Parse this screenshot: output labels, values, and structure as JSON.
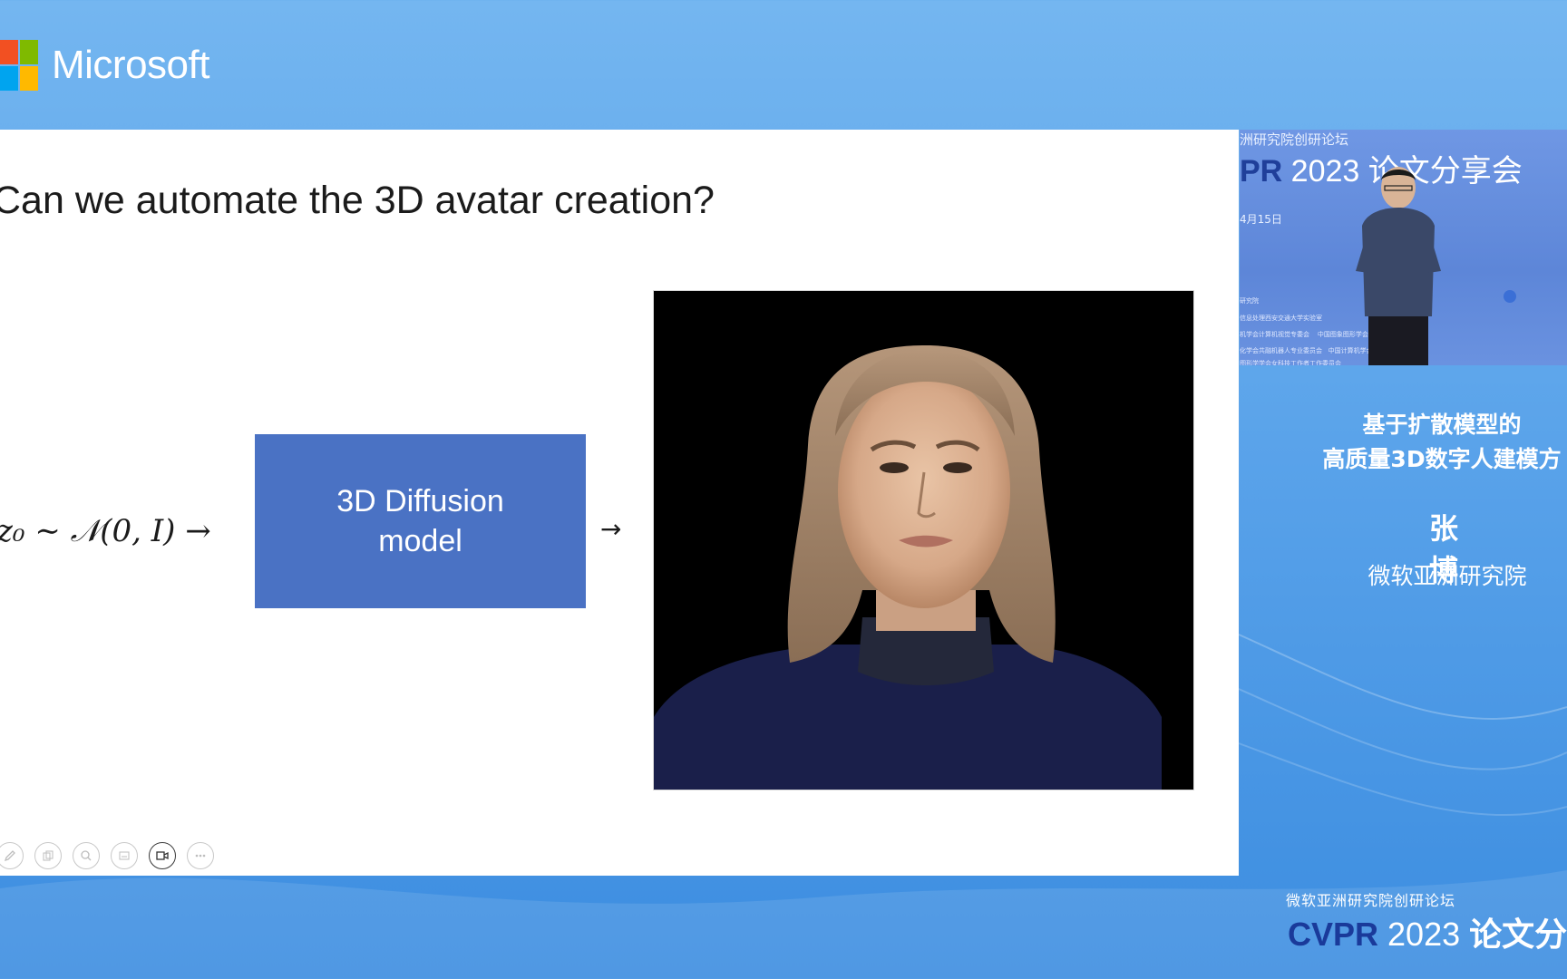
{
  "brand": {
    "name": "Microsoft",
    "logo_colors": [
      "#f25022",
      "#7fba00",
      "#00a4ef",
      "#ffb900"
    ]
  },
  "slide": {
    "title": "Can we automate the 3D avatar creation?",
    "formula": "z₀ ∼ 𝒩(0, I) →",
    "diffusion_box": {
      "line1": "3D Diffusion",
      "line2": "model"
    },
    "output_arrow": "→",
    "toolbar": [
      "pen-icon",
      "copy-icon",
      "zoom-icon",
      "subtitle-icon",
      "camera-icon",
      "more-icon"
    ]
  },
  "camera_panel": {
    "forum_text": "洲研究院创研论坛",
    "event_partial_bold": "PR",
    "event_partial_rest": " 2023 论文分享会",
    "date": "4月15日"
  },
  "speaker": {
    "title_line1": "基于扩散模型的",
    "title_line2": "高质量3D数字人建模方",
    "name": "张 博",
    "org": "微软亚洲研究院"
  },
  "footer": {
    "forum": "微软亚洲研究院创研论坛",
    "event_bold": "CVPR",
    "event_year": " 2023 ",
    "event_cn": "论文分享"
  },
  "colors": {
    "background": "#5aa3ea",
    "diffusion_box": "#4a72c4",
    "slide_bg": "#ffffff"
  }
}
